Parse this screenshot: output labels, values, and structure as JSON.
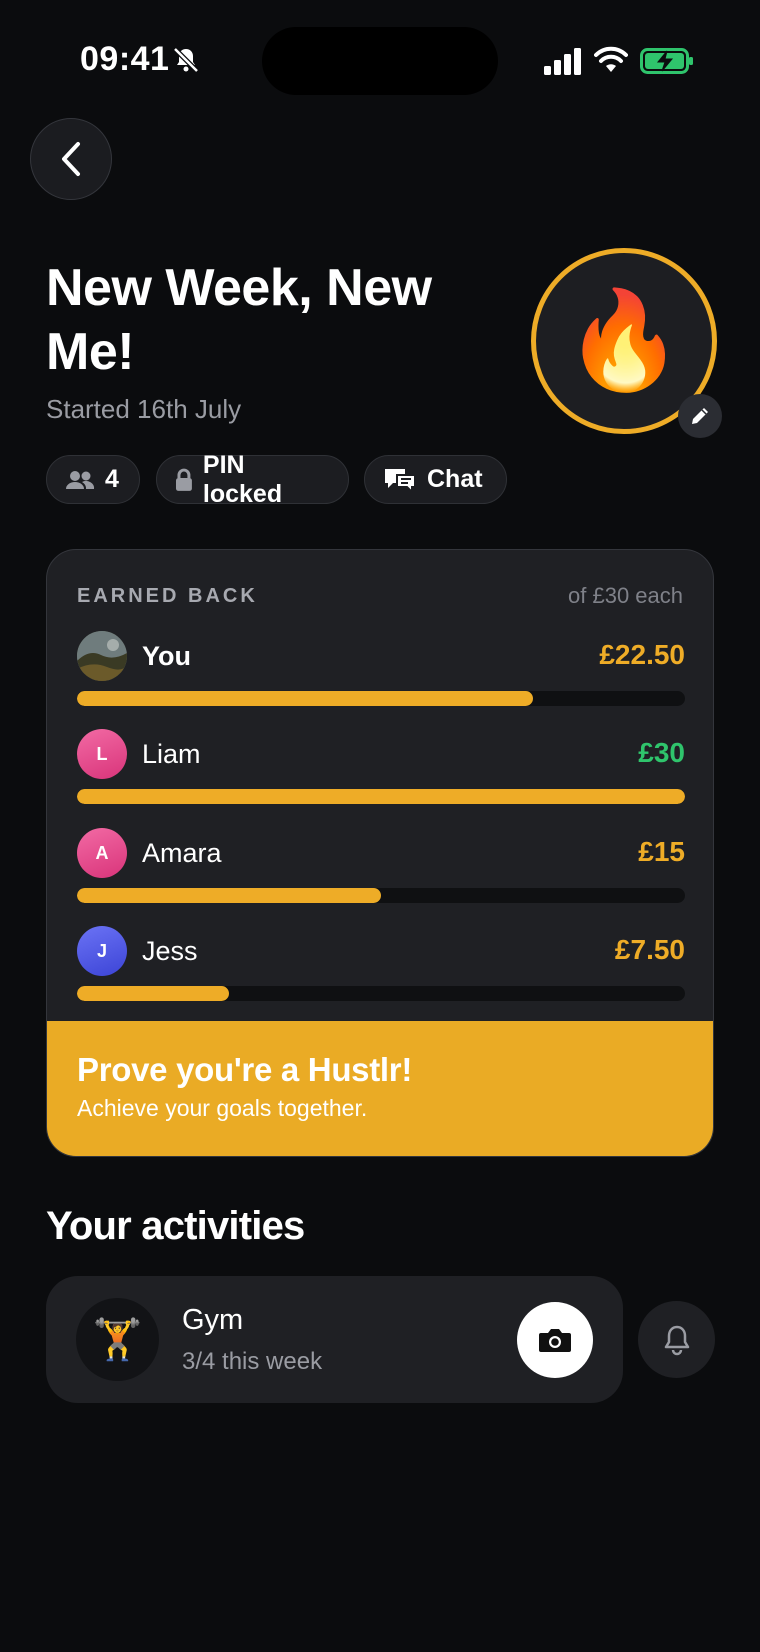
{
  "status_bar": {
    "time": "09:41"
  },
  "header": {
    "title": "New Week, New Me!",
    "subtitle": "Started 16th July",
    "avatar_emoji": "🔥"
  },
  "chips": {
    "members_count": "4",
    "pin_label": "PIN locked",
    "chat_label": "Chat"
  },
  "earned": {
    "label": "EARNED BACK",
    "note": "of £30 each",
    "rows": [
      {
        "name": "You",
        "amount": "£22.50",
        "progress": 0.75,
        "initial": "",
        "amount_color": "#eeac27"
      },
      {
        "name": "Liam",
        "amount": "£30",
        "progress": 1.0,
        "initial": "L",
        "amount_color": "#2fc46c"
      },
      {
        "name": "Amara",
        "amount": "£15",
        "progress": 0.5,
        "initial": "A",
        "amount_color": "#eeac27"
      },
      {
        "name": "Jess",
        "amount": "£7.50",
        "progress": 0.25,
        "initial": "J",
        "amount_color": "#eeac27"
      }
    ]
  },
  "banner": {
    "title": "Prove you're a Hustlr!",
    "subtitle": "Achieve your goals together."
  },
  "activities": {
    "section_title": "Your activities",
    "items": [
      {
        "emoji": "🏋️",
        "name": "Gym",
        "progress_text": "3/4 this week"
      }
    ]
  },
  "colors": {
    "accent": "#eeac27",
    "success": "#2fc46c",
    "background": "#0b0c0e",
    "card": "#1f2024"
  }
}
